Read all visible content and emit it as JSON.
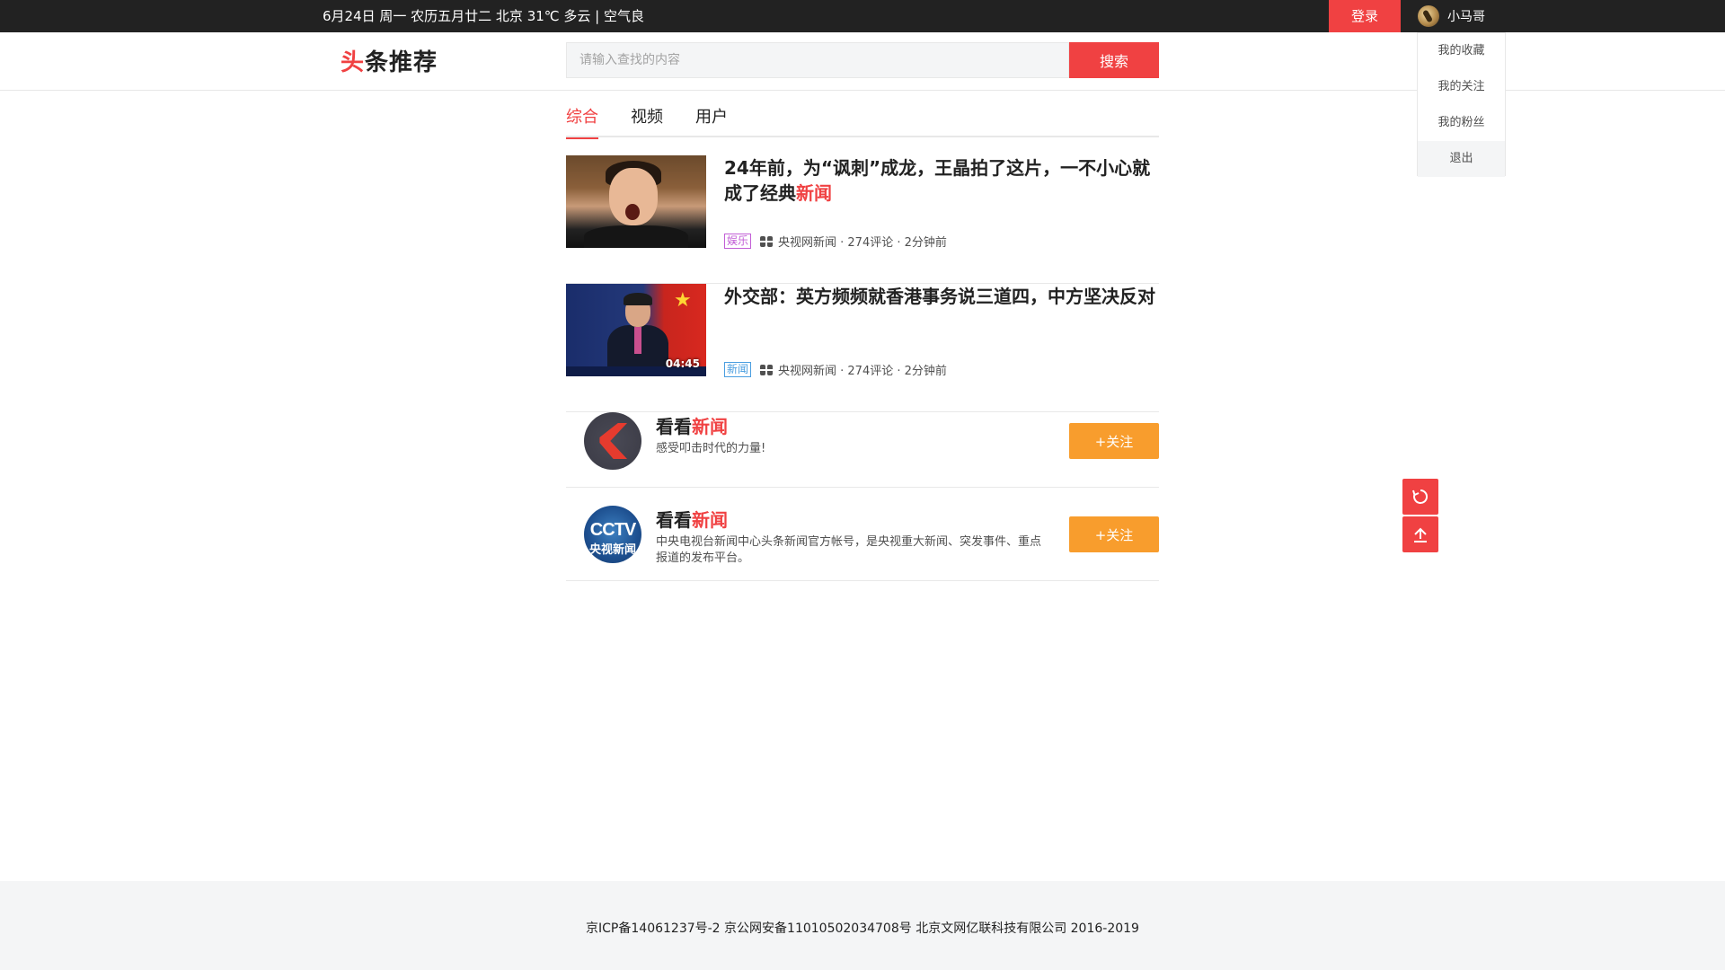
{
  "topbar": {
    "info": "6月24日 周一 农历五月廿二  北京 31℃ 多云 | 空气良",
    "login_label": "登录",
    "user_name": "小马哥"
  },
  "dropdown": {
    "items": [
      "我的收藏",
      "我的关注",
      "我的粉丝",
      "退出"
    ]
  },
  "header": {
    "logo_part1": "头",
    "logo_part2": "条推荐",
    "search_placeholder": "请输入查找的内容",
    "search_label": "搜索"
  },
  "tabs": [
    {
      "label": "综合",
      "active": true
    },
    {
      "label": "视频",
      "active": false
    },
    {
      "label": "用户",
      "active": false
    }
  ],
  "news": [
    {
      "title_main": "24年前，为“讽刺”成龙，王晶拍了这片，一不小心就成了经典",
      "title_highlight": "新闻",
      "tag": "娱乐",
      "meta": "央视网新闻 · 274评论 · 2分钟前"
    },
    {
      "title_main": "外交部：英方频频就香港事务说三道四，中方坚决反对",
      "title_highlight": "",
      "tag": "新闻",
      "duration": "04:45",
      "meta": "央视网新闻 · 274评论 · 2分钟前"
    }
  ],
  "users": [
    {
      "name_main": "看看",
      "name_highlight": "新闻",
      "desc": "感受叩击时代的力量!",
      "follow_label": "+关注"
    },
    {
      "name_main": "看看",
      "name_highlight": "新闻",
      "desc": "中央电视台新闻中心头条新闻官方帐号，是央视重大新闻、突发事件、重点报道的发布平台。",
      "follow_label": "+关注",
      "avatar_text_1": "CCTV",
      "avatar_text_2": "央视新闻"
    }
  ],
  "float_buttons": [
    "refresh-icon",
    "back-to-top-icon"
  ],
  "footer": {
    "text": "京ICP备14061237号-2  京公网安备11010502034708号  北京文网亿联科技有限公司 2016-2019"
  },
  "colors": {
    "accent": "#f04142",
    "follow": "#f89d2d",
    "topbar": "#222222"
  }
}
